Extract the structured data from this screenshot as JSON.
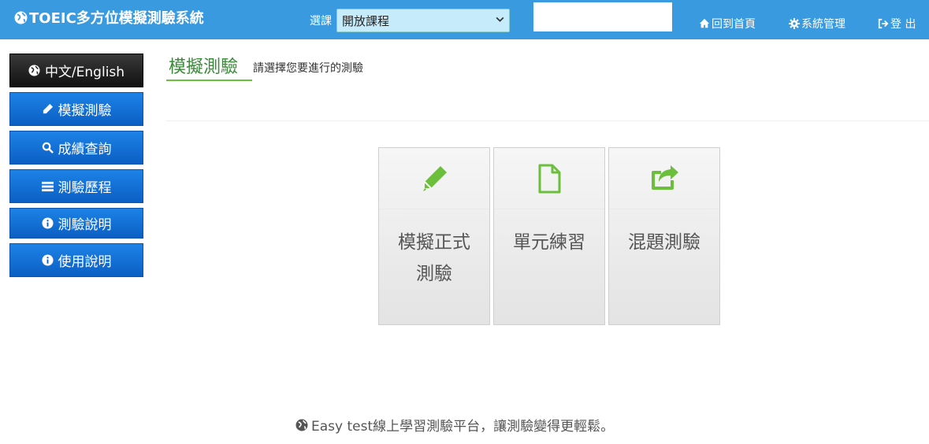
{
  "header": {
    "title": "TOEIC多方位模擬測驗系統",
    "course_label": "選課",
    "course_selected": "開放課程",
    "search_value": "",
    "nav": {
      "home": "回到首頁",
      "admin": "系統管理",
      "logout": "登 出"
    }
  },
  "sidebar": {
    "items": [
      {
        "label": "中文/English",
        "icon": "globe-icon"
      },
      {
        "label": "模擬測驗",
        "icon": "pencil-icon"
      },
      {
        "label": "成績查詢",
        "icon": "search-icon"
      },
      {
        "label": "測驗歷程",
        "icon": "list-icon"
      },
      {
        "label": "測驗說明",
        "icon": "info-icon"
      },
      {
        "label": "使用說明",
        "icon": "info-icon"
      }
    ]
  },
  "main": {
    "title": "模擬測驗",
    "subtitle": "請選擇您要進行的測驗",
    "cards": [
      {
        "line1": "模擬正式",
        "line2": "測驗",
        "icon": "pencil-icon"
      },
      {
        "line1": "單元練習",
        "line2": "",
        "icon": "file-icon"
      },
      {
        "line1": "混題測驗",
        "line2": "",
        "icon": "share-icon"
      }
    ]
  },
  "footer": {
    "text": "Easy test線上學習測驗平台，讓測驗變得更輕鬆。"
  },
  "colors": {
    "topbar": "#3a9ae0",
    "sidebar_button": "#0b5fc4",
    "accent_green": "#6bbf3c"
  }
}
